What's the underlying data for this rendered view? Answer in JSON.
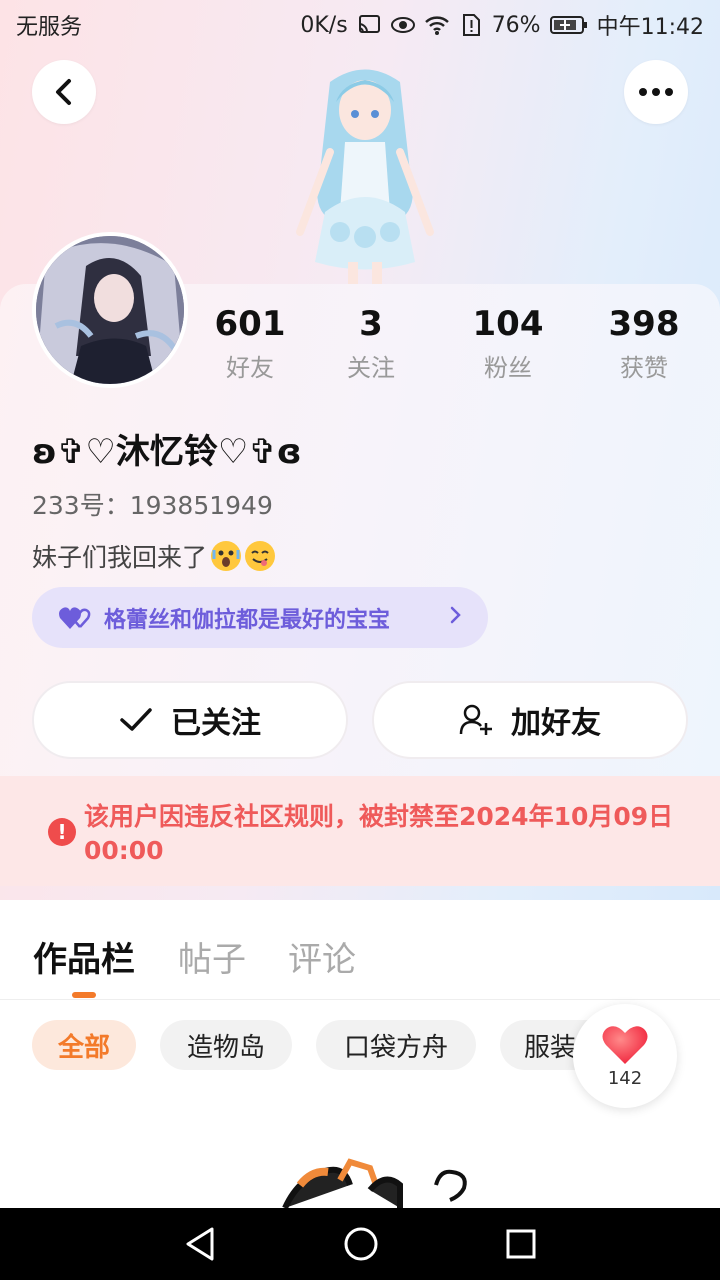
{
  "status_bar": {
    "carrier": "无服务",
    "speed": "0K/s",
    "battery": "76%",
    "time": "中午11:42"
  },
  "profile": {
    "name": "ʚ✞♡沐忆铃♡✞ɞ",
    "uid": "233号：193851949",
    "bio": "妹子们我回来了",
    "stats": [
      {
        "value": "601",
        "label": "好友"
      },
      {
        "value": "3",
        "label": "关注"
      },
      {
        "value": "104",
        "label": "粉丝"
      },
      {
        "value": "398",
        "label": "获赞"
      }
    ],
    "guild": "格蕾丝和伽拉都是最好的宝宝"
  },
  "actions": {
    "follow_label": "已关注",
    "add_friend_label": "加好友"
  },
  "ban_notice": "该用户因违反社区规则，被封禁至2024年10月09日 00:00",
  "tabs": [
    {
      "label": "作品栏",
      "active": true
    },
    {
      "label": "帖子",
      "active": false
    },
    {
      "label": "评论",
      "active": false
    }
  ],
  "chips": [
    {
      "label": "全部",
      "active": true
    },
    {
      "label": "造物岛",
      "active": false
    },
    {
      "label": "口袋方舟",
      "active": false
    },
    {
      "label": "服装",
      "active": false
    }
  ],
  "like_count": "142",
  "colors": {
    "accent": "#f37a2a",
    "guild_text": "#6d5ddb",
    "ban_text": "#ef5a5a",
    "ban_bg": "#fde7e7"
  }
}
